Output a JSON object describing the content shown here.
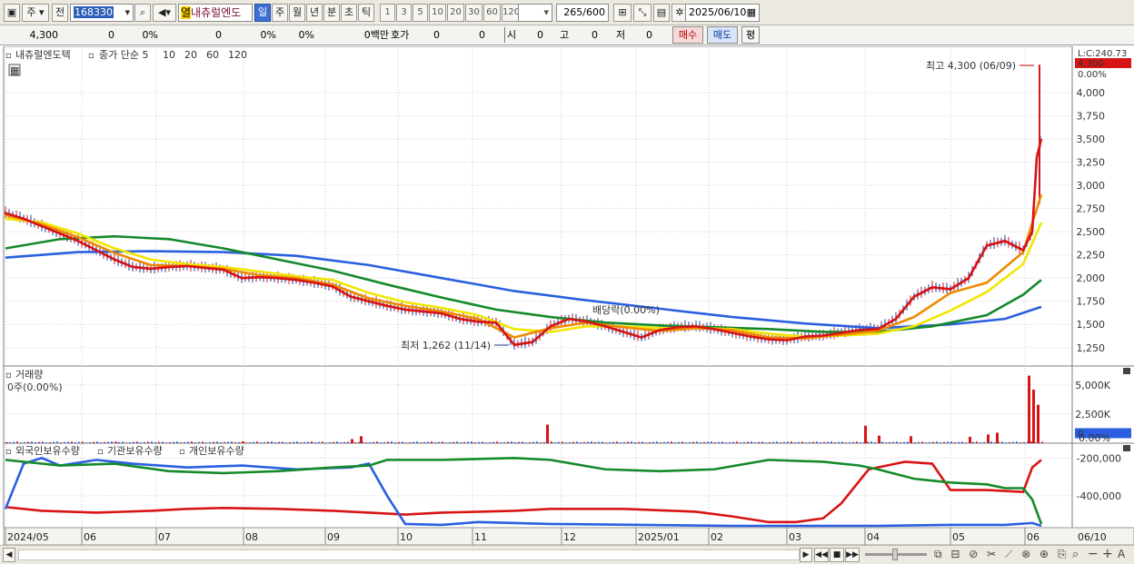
{
  "toolbar": {
    "mode": "주",
    "prefix": "전",
    "code": "168330",
    "tag": "열",
    "stock_name": "내츄럴엔도",
    "periods": [
      "일",
      "주",
      "월",
      "년",
      "분",
      "초",
      "틱"
    ],
    "active_period": "일",
    "intervals": [
      "1",
      "3",
      "5",
      "10",
      "20",
      "30",
      "60",
      "120"
    ],
    "count": "265",
    "count_total": "/600",
    "date": "2025/06/10"
  },
  "quote": {
    "price": "4,300",
    "change": "0",
    "change_pct": "0%",
    "volume": "0",
    "vol_pct": "0%",
    "turnover_pct": "0%",
    "amount": "0백만",
    "hoga_label": "호가",
    "hoga_bid": "0",
    "hoga_ask": "0",
    "open_label": "시",
    "open": "0",
    "high_label": "고",
    "high": "0",
    "low_label": "저",
    "low": "0",
    "buy": "매수",
    "sell": "매도",
    "eval": "평"
  },
  "chart_data": [
    {
      "type": "line",
      "panel": "price",
      "title": "내츄럴엔도텍",
      "legend": [
        "종가 단순 5",
        "10",
        "20",
        "60",
        "120"
      ],
      "legend_colors": [
        "#d81414",
        "#f08a00",
        "#f2e600",
        "#148a2a",
        "#2a5fe0"
      ],
      "y_ticks": [
        "4,000",
        "3,750",
        "3,500",
        "3,250",
        "3,000",
        "2,750",
        "2,500",
        "2,250",
        "2,000",
        "1,750",
        "1,500",
        "1,250"
      ],
      "ylim": [
        1150,
        4400
      ],
      "top_labels": [
        "L:C:240.73",
        "4,300",
        "0.00%"
      ],
      "x_labels": [
        "2024/05",
        "06",
        "07",
        "08",
        "09",
        "10",
        "11",
        "12",
        "2025/01",
        "02",
        "03",
        "04",
        "05",
        "06",
        "06/10"
      ],
      "annotations": {
        "high": "최고 4,300 (06/09)",
        "low": "최저 1,262 (11/14)",
        "dividend": "배당락(0.00%)"
      },
      "series": [
        {
          "name": "5",
          "color": "#d81414",
          "x": [
            0,
            20,
            40,
            60,
            80,
            100,
            120,
            140,
            160,
            180,
            200,
            220,
            240,
            260,
            280,
            300,
            320,
            340,
            360,
            380,
            400,
            420,
            440,
            460,
            480,
            500,
            520,
            540,
            560,
            580,
            600,
            620,
            640,
            660,
            680,
            700,
            720,
            740,
            760,
            780,
            800,
            820,
            840,
            860,
            880,
            900,
            920,
            940,
            960,
            980,
            1000,
            1020,
            1040,
            1060,
            1080,
            1100,
            1120,
            1130,
            1135,
            1140
          ],
          "values": [
            2700,
            2640,
            2560,
            2480,
            2400,
            2300,
            2200,
            2120,
            2100,
            2120,
            2130,
            2110,
            2090,
            2000,
            2010,
            2000,
            1980,
            1950,
            1910,
            1800,
            1750,
            1700,
            1660,
            1640,
            1620,
            1560,
            1530,
            1520,
            1280,
            1310,
            1480,
            1560,
            1530,
            1480,
            1420,
            1360,
            1440,
            1470,
            1480,
            1450,
            1410,
            1370,
            1340,
            1330,
            1370,
            1380,
            1410,
            1440,
            1450,
            1560,
            1800,
            1900,
            1880,
            2000,
            2350,
            2400,
            2300,
            2500,
            3300,
            3500
          ]
        },
        {
          "name": "10",
          "color": "#f08a00",
          "x": [
            0,
            40,
            80,
            120,
            160,
            200,
            240,
            280,
            320,
            360,
            400,
            440,
            480,
            520,
            560,
            600,
            640,
            680,
            720,
            760,
            800,
            840,
            880,
            920,
            960,
            1000,
            1040,
            1080,
            1120,
            1140
          ],
          "values": [
            2680,
            2580,
            2440,
            2270,
            2140,
            2130,
            2100,
            2030,
            2000,
            1930,
            1780,
            1700,
            1640,
            1560,
            1360,
            1460,
            1520,
            1470,
            1430,
            1460,
            1440,
            1360,
            1350,
            1390,
            1430,
            1580,
            1840,
            1950,
            2280,
            2900
          ]
        },
        {
          "name": "20",
          "color": "#f2e600",
          "x": [
            0,
            40,
            80,
            120,
            160,
            200,
            240,
            280,
            320,
            360,
            400,
            440,
            480,
            520,
            560,
            600,
            640,
            680,
            720,
            760,
            800,
            840,
            880,
            920,
            960,
            1000,
            1040,
            1080,
            1120,
            1140
          ],
          "values": [
            2640,
            2600,
            2480,
            2320,
            2200,
            2150,
            2120,
            2070,
            2020,
            1980,
            1840,
            1740,
            1680,
            1600,
            1450,
            1420,
            1480,
            1480,
            1460,
            1460,
            1450,
            1400,
            1370,
            1380,
            1400,
            1480,
            1650,
            1850,
            2150,
            2600
          ]
        },
        {
          "name": "60",
          "color": "#148a2a",
          "x": [
            0,
            60,
            120,
            180,
            240,
            300,
            360,
            420,
            480,
            540,
            600,
            660,
            720,
            780,
            840,
            900,
            960,
            1020,
            1080,
            1120,
            1140
          ],
          "values": [
            2320,
            2420,
            2450,
            2420,
            2320,
            2200,
            2080,
            1930,
            1790,
            1660,
            1580,
            1520,
            1490,
            1470,
            1450,
            1420,
            1420,
            1480,
            1600,
            1820,
            1980
          ]
        },
        {
          "name": "120",
          "color": "#2a5fe0",
          "x": [
            0,
            80,
            160,
            240,
            320,
            400,
            480,
            560,
            640,
            720,
            800,
            880,
            960,
            1040,
            1100,
            1140
          ],
          "values": [
            2220,
            2280,
            2290,
            2280,
            2240,
            2140,
            2000,
            1860,
            1760,
            1670,
            1580,
            1510,
            1460,
            1500,
            1560,
            1690
          ]
        }
      ]
    },
    {
      "type": "bar",
      "panel": "volume",
      "title": "거래량",
      "summary": "0주(0.00%)",
      "y_ticks": [
        "5,000K",
        "2,500K",
        "0.00%"
      ],
      "current_value": "0",
      "ylim": [
        0,
        6000
      ],
      "x": [
        0,
        120,
        260,
        380,
        390,
        595,
        945,
        960,
        995,
        1060,
        1080,
        1090,
        1125,
        1130,
        1135
      ],
      "values": [
        80,
        120,
        150,
        350,
        600,
        1600,
        1500,
        650,
        600,
        550,
        750,
        900,
        5800,
        4600,
        3300
      ]
    },
    {
      "type": "line",
      "panel": "holdings",
      "legend": [
        "외국인보유수량",
        "기관보유수량",
        "개인보유수량"
      ],
      "legend_colors": [
        "#d81414",
        "#2a5fe0",
        "#148a2a"
      ],
      "y_ticks": [
        "-200,000",
        "-400,000"
      ],
      "ylim": [
        -560000,
        -160000
      ],
      "series": [
        {
          "name": "외국인보유수량",
          "color": "#d81414",
          "x": [
            0,
            40,
            100,
            160,
            200,
            240,
            300,
            360,
            400,
            440,
            480,
            560,
            600,
            680,
            760,
            800,
            840,
            870,
            900,
            920,
            950,
            980,
            990,
            1020,
            1040,
            1080,
            1120,
            1130,
            1140
          ],
          "values": [
            -460000,
            -480000,
            -490000,
            -480000,
            -470000,
            -465000,
            -470000,
            -480000,
            -490000,
            -500000,
            -490000,
            -480000,
            -470000,
            -470000,
            -485000,
            -510000,
            -540000,
            -540000,
            -520000,
            -440000,
            -260000,
            -230000,
            -220000,
            -230000,
            -370000,
            -370000,
            -380000,
            -250000,
            -210000
          ]
        },
        {
          "name": "기관보유수량",
          "color": "#2a5fe0",
          "x": [
            0,
            20,
            40,
            60,
            100,
            140,
            200,
            260,
            320,
            380,
            400,
            420,
            440,
            480,
            520,
            600,
            700,
            800,
            900,
            960,
            1040,
            1100,
            1130,
            1140
          ],
          "values": [
            -470000,
            -230000,
            -200000,
            -240000,
            -210000,
            -230000,
            -250000,
            -240000,
            -260000,
            -250000,
            -230000,
            -400000,
            -550000,
            -555000,
            -540000,
            -550000,
            -555000,
            -560000,
            -560000,
            -560000,
            -555000,
            -555000,
            -545000,
            -560000
          ]
        },
        {
          "name": "개인보유수량",
          "color": "#148a2a",
          "x": [
            0,
            60,
            120,
            180,
            240,
            300,
            360,
            400,
            420,
            480,
            560,
            600,
            660,
            720,
            780,
            840,
            900,
            940,
            960,
            1000,
            1040,
            1080,
            1100,
            1120,
            1130,
            1140
          ],
          "values": [
            -210000,
            -240000,
            -230000,
            -270000,
            -280000,
            -270000,
            -250000,
            -240000,
            -210000,
            -210000,
            -200000,
            -210000,
            -260000,
            -270000,
            -260000,
            -210000,
            -220000,
            -240000,
            -260000,
            -310000,
            -330000,
            -340000,
            -360000,
            -360000,
            -420000,
            -550000
          ]
        }
      ]
    }
  ]
}
